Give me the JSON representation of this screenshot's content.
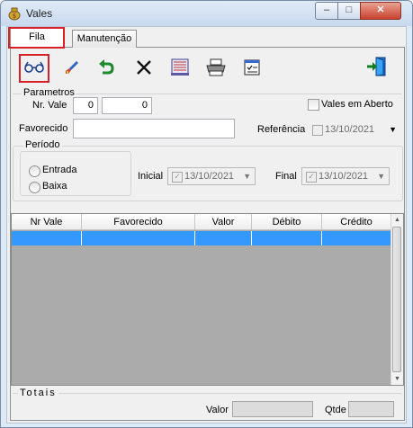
{
  "window": {
    "title": "Vales",
    "min": "–",
    "max": "□",
    "close": "✕"
  },
  "tabs": {
    "fila": "Fila",
    "manutencao": "Manutenção"
  },
  "toolbar": {
    "view_icon": "glasses-icon",
    "edit_icon": "brush-icon",
    "undo_icon": "undo-arrow-icon",
    "delete_icon": "x-icon",
    "report_icon": "report-icon",
    "print_icon": "printer-icon",
    "checklist_icon": "checklist-icon",
    "exit_icon": "exit-door-icon"
  },
  "parametros": {
    "legend": "Parametros",
    "nr_vale_label": "Nr. Vale",
    "nr_vale_from": "0",
    "nr_vale_to": "0",
    "vales_aberto_label": "Vales em Aberto",
    "favorecido_label": "Favorecido",
    "favorecido_value": "",
    "referencia_label": "Referência",
    "referencia_date": "13/10/2021"
  },
  "periodo": {
    "legend": "Período",
    "entrada": "Entrada",
    "baixa": "Baixa",
    "inicial_label": "Inicial",
    "inicial_date": "13/10/2021",
    "final_label": "Final",
    "final_date": "13/10/2021"
  },
  "grid": {
    "columns": [
      "Nr Vale",
      "Favorecido",
      "Valor",
      "Débito",
      "Crédito"
    ]
  },
  "totais": {
    "legend": "Totais",
    "valor_label": "Valor",
    "valor": "",
    "qtde_label": "Qtde",
    "qtde": ""
  },
  "colors": {
    "highlight": "#d8202b",
    "selection": "#3399ff"
  }
}
